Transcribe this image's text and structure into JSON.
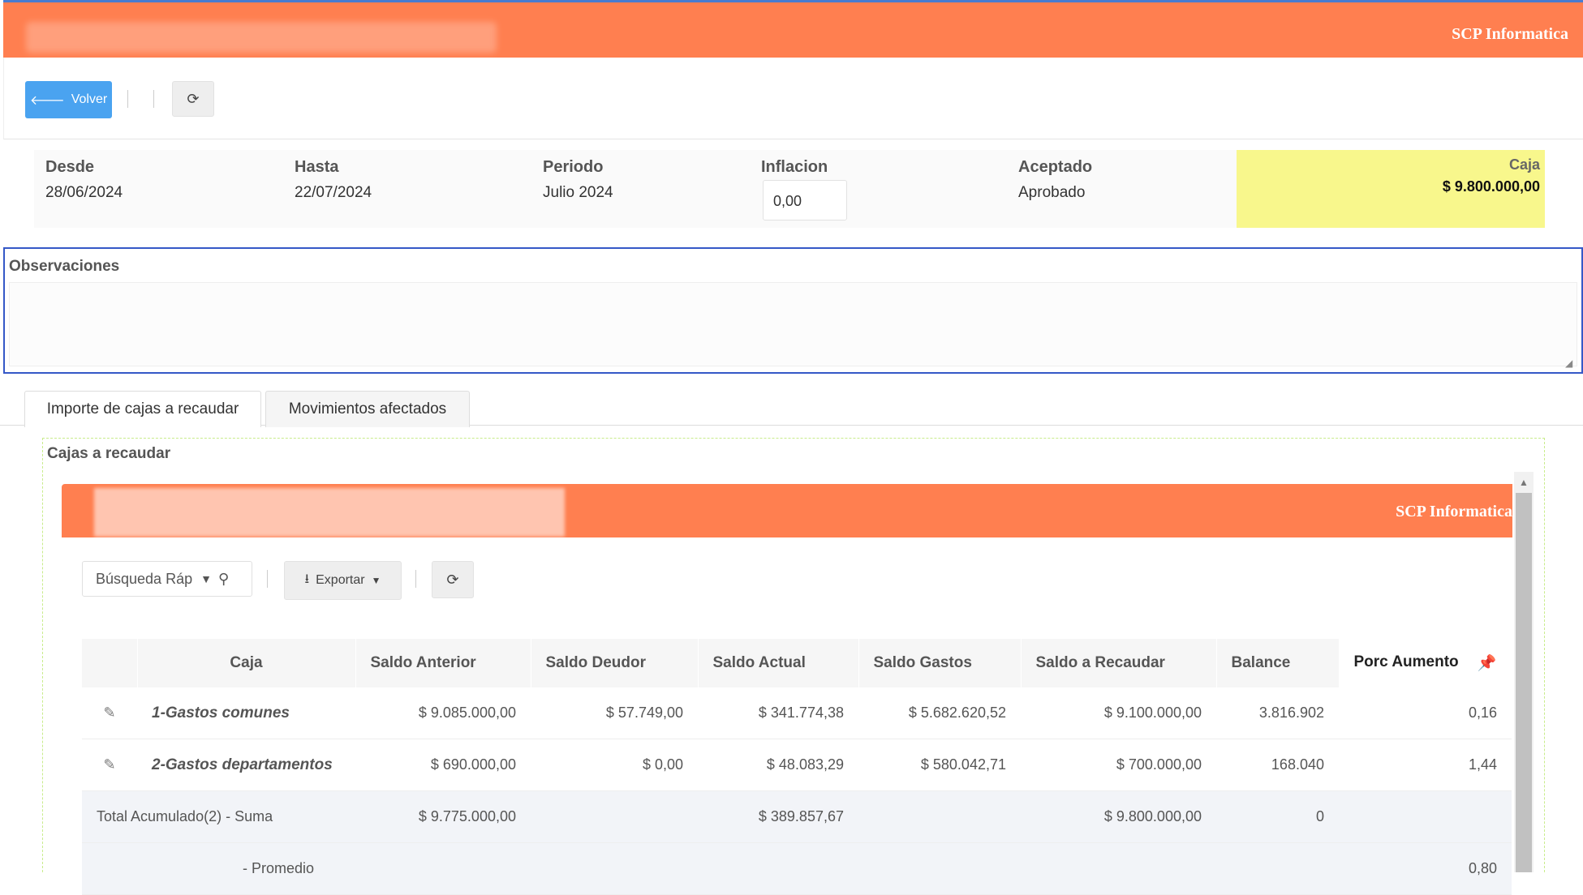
{
  "header": {
    "brand": "SCP Informatica"
  },
  "toolbar": {
    "back_label": "Volver"
  },
  "info": {
    "desde_label": "Desde",
    "desde_value": "28/06/2024",
    "hasta_label": "Hasta",
    "hasta_value": "22/07/2024",
    "periodo_label": "Periodo",
    "periodo_value": "Julio 2024",
    "inflacion_label": "Inflacion",
    "inflacion_value": "0,00",
    "aceptado_label": "Aceptado",
    "aceptado_value": "Aprobado",
    "caja_label": "Caja",
    "caja_value": "$ 9.800.000,00"
  },
  "observaciones": {
    "label": "Observaciones",
    "value": ""
  },
  "tabs": [
    {
      "label": "Importe de cajas a recaudar"
    },
    {
      "label": "Movimientos afectados"
    }
  ],
  "panel": {
    "title": "Cajas a recaudar",
    "brand": "SCP Informatica",
    "search_placeholder": "Búsqueda Ráp",
    "export_label": "Exportar"
  },
  "table": {
    "columns": [
      "Caja",
      "Saldo Anterior",
      "Saldo Deudor",
      "Saldo Actual",
      "Saldo Gastos",
      "Saldo a Recaudar",
      "Balance",
      "Porc Aumento"
    ],
    "rows": [
      {
        "caja": "1-Gastos comunes",
        "saldo_anterior": "$ 9.085.000,00",
        "saldo_deudor": "$ 57.749,00",
        "saldo_actual": "$ 341.774,38",
        "saldo_gastos": "$ 5.682.620,52",
        "saldo_recaudar": "$ 9.100.000,00",
        "balance": "3.816.902",
        "porc": "0,16"
      },
      {
        "caja": "2-Gastos departamentos",
        "saldo_anterior": "$ 690.000,00",
        "saldo_deudor": "$ 0,00",
        "saldo_actual": "$ 48.083,29",
        "saldo_gastos": "$ 580.042,71",
        "saldo_recaudar": "$ 700.000,00",
        "balance": "168.040",
        "porc": "1,44"
      }
    ],
    "total": {
      "label": "Total Acumulado(2) - Suma",
      "saldo_anterior": "$ 9.775.000,00",
      "saldo_actual": "$ 389.857,67",
      "saldo_recaudar": "$ 9.800.000,00",
      "balance": "0"
    },
    "promedio": {
      "label": "- Promedio",
      "porc": "0,80"
    }
  }
}
